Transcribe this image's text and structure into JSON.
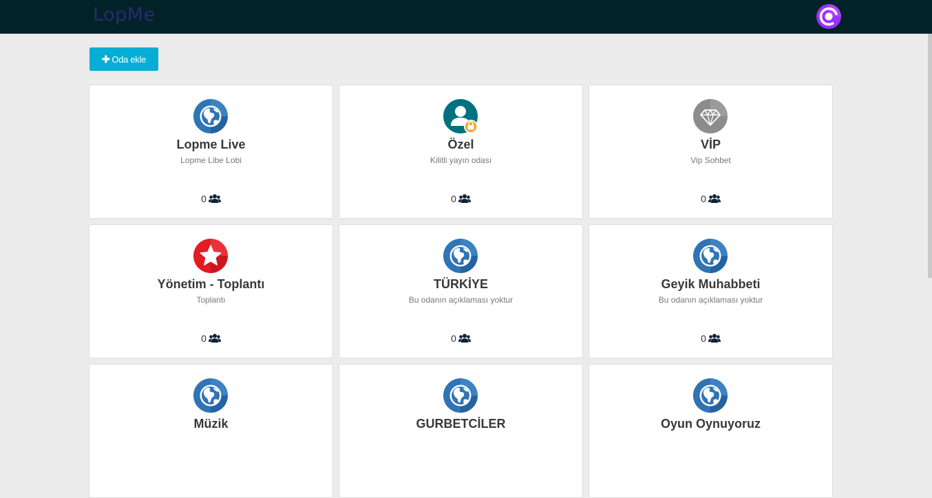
{
  "header": {
    "logo_text": "LopMe",
    "app_icon": "power-logo-icon"
  },
  "toolbar": {
    "add_room_label": "Oda ekle",
    "add_room_icon": "plus-icon"
  },
  "colors": {
    "topbar": "#02222a",
    "accent": "#06aed5",
    "globe": "#2f74b5",
    "private": "#00717f",
    "lock": "#f5a623",
    "vip": "#8c8c8c",
    "star": "#e31b23",
    "logo_ring": "#9b30ff"
  },
  "rooms": [
    {
      "title": "Lopme Live",
      "description": "Lopme Libe Lobi",
      "count": "0",
      "icon": "globe-icon"
    },
    {
      "title": "Özel",
      "description": "Kilitli yayın odası",
      "count": "0",
      "icon": "user-lock-icon"
    },
    {
      "title": "VİP",
      "description": "Vip Sohbet",
      "count": "0",
      "icon": "diamond-icon"
    },
    {
      "title": "Yönetim - Toplantı",
      "description": "Toplantı",
      "count": "0",
      "icon": "star-icon"
    },
    {
      "title": "TÜRKİYE",
      "description": "Bu odanın açıklaması yoktur",
      "count": "0",
      "icon": "globe-icon"
    },
    {
      "title": "Geyik Muhabbeti",
      "description": "Bu odanın açıklaması yoktur",
      "count": "0",
      "icon": "globe-icon"
    },
    {
      "title": "Müzik",
      "description": "",
      "count": "",
      "icon": "globe-icon"
    },
    {
      "title": "GURBETCİLER",
      "description": "",
      "count": "",
      "icon": "globe-icon"
    },
    {
      "title": "Oyun Oynuyoruz",
      "description": "",
      "count": "",
      "icon": "globe-icon"
    }
  ]
}
